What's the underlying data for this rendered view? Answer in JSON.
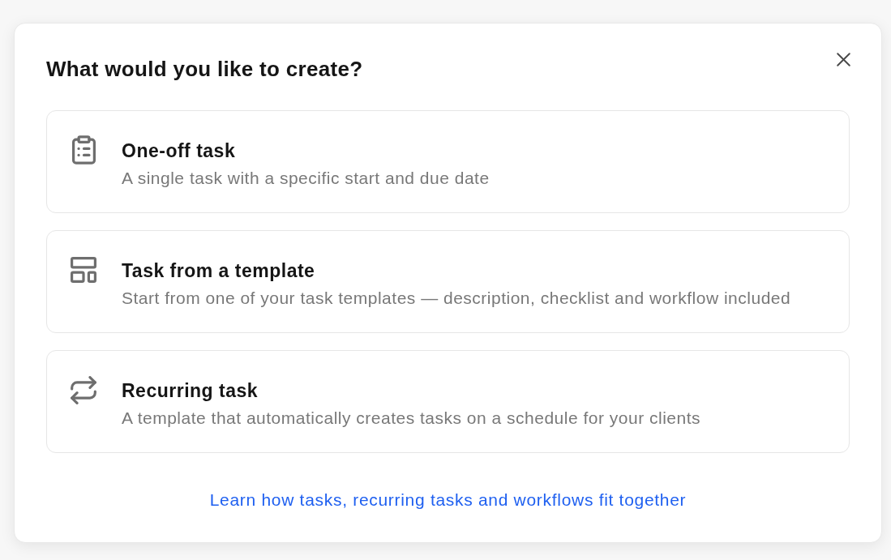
{
  "dialog": {
    "title": "What would you like to create?",
    "options": [
      {
        "kind": "one-off",
        "title": "One-off task",
        "description": "A single task with a specific start and due date"
      },
      {
        "kind": "template",
        "title": "Task from a template",
        "description": "Start from one of your task templates — description, checklist and workflow included"
      },
      {
        "kind": "recurring",
        "title": "Recurring task",
        "description": "A template that automatically creates tasks on a schedule for your clients"
      }
    ],
    "help_link": "Learn how tasks, recurring tasks and workflows fit together"
  }
}
